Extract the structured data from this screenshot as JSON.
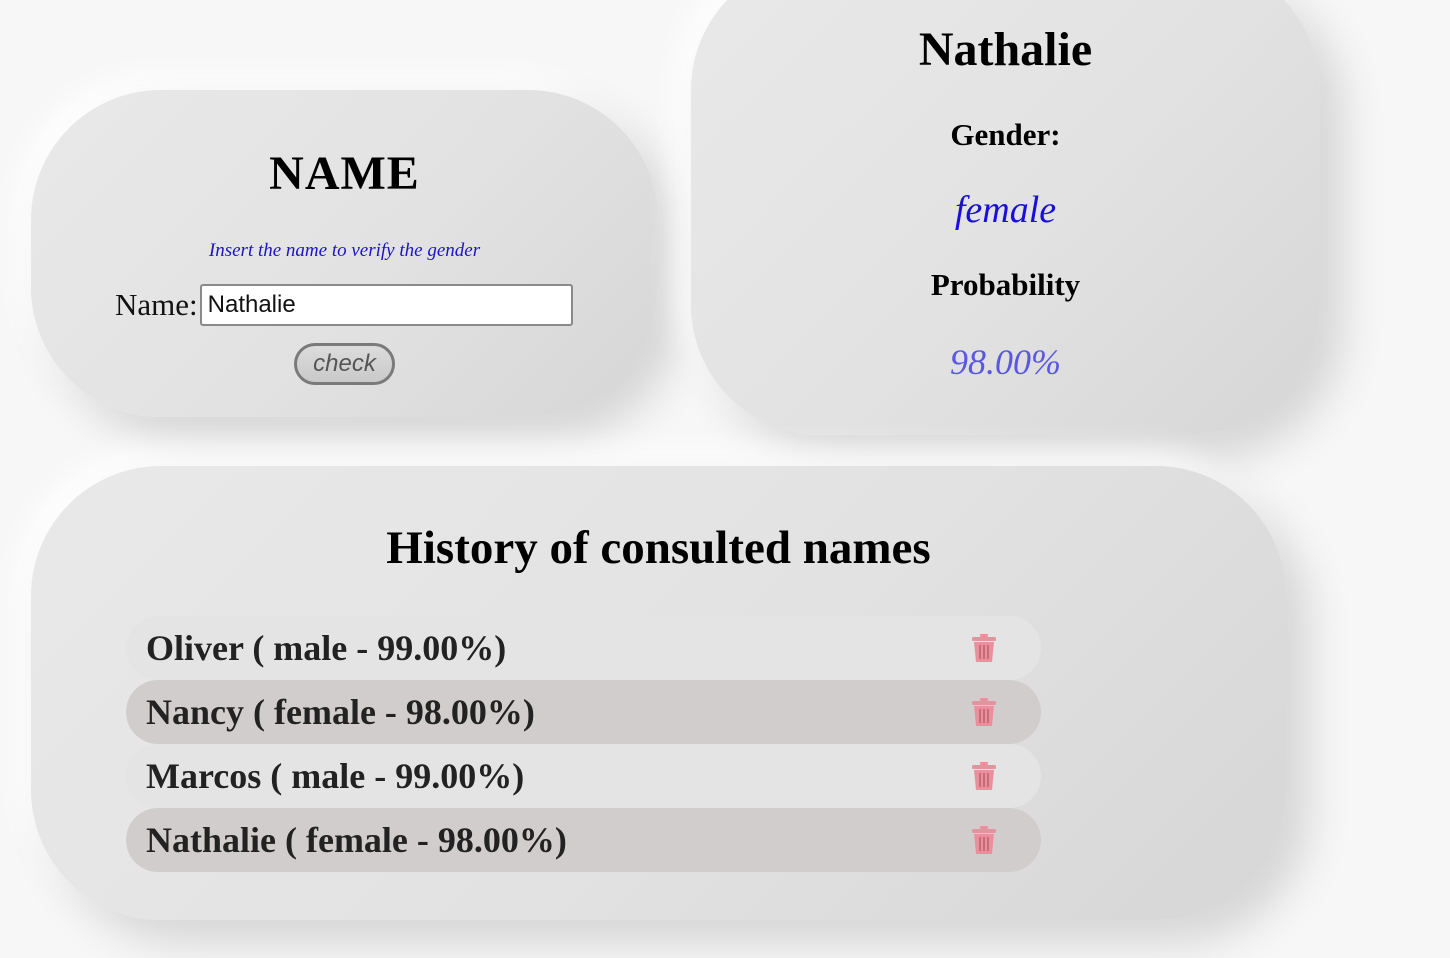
{
  "name_form": {
    "title": "NAME",
    "hint": "Insert the name to verify the gender",
    "label": "Name:",
    "input_value": "Nathalie",
    "button_label": "check"
  },
  "result": {
    "name": "Nathalie",
    "gender_label": "Gender:",
    "gender_value": "female",
    "probability_label": "Probability",
    "probability_value": "98.00%"
  },
  "history": {
    "title": "History of consulted names",
    "items": [
      {
        "text": "Oliver ( male - 99.00%)",
        "icon": "trash-icon"
      },
      {
        "text": "Nancy ( female - 98.00%)",
        "icon": "trash-icon"
      },
      {
        "text": "Marcos ( male - 99.00%)",
        "icon": "trash-icon"
      },
      {
        "text": "Nathalie ( female - 98.00%)",
        "icon": "trash-icon"
      }
    ]
  },
  "colors": {
    "hint": "#1a13c9",
    "gender_value": "#1a0fd6",
    "probability_value": "#5a57e0",
    "trash_icon": "#e8909c"
  }
}
